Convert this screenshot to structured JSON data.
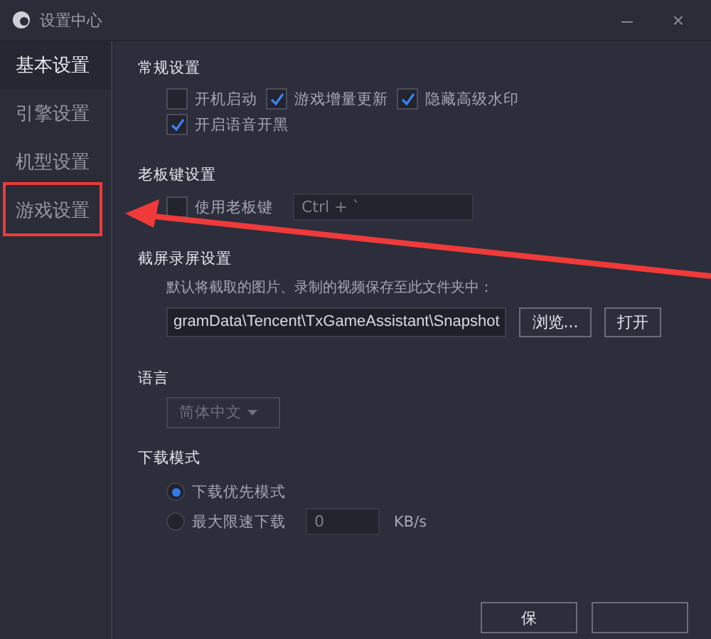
{
  "window": {
    "title": "设置中心",
    "minimize_label": "–",
    "close_label": "×"
  },
  "sidebar": {
    "items": [
      {
        "label": "基本设置",
        "selected": true
      },
      {
        "label": "引擎设置",
        "selected": false
      },
      {
        "label": "机型设置",
        "selected": false
      },
      {
        "label": "游戏设置",
        "selected": false
      }
    ]
  },
  "general": {
    "title": "常规设置",
    "options": [
      {
        "label": "开机启动",
        "checked": false
      },
      {
        "label": "游戏增量更新",
        "checked": true
      },
      {
        "label": "隐藏高级水印",
        "checked": true
      },
      {
        "label": "开启语音开黑",
        "checked": true
      }
    ]
  },
  "boss_key": {
    "title": "老板键设置",
    "label": "使用老板键",
    "checked": false,
    "value": "Ctrl + `"
  },
  "screenshot": {
    "title": "截屏录屏设置",
    "description": "默认将截取的图片、录制的视频保存至此文件夹中：",
    "path": "gramData\\Tencent\\TxGameAssistant\\Snapshot",
    "buttons": [
      "浏览...",
      "打开"
    ]
  },
  "language": {
    "title": "语言",
    "value": "简体中文"
  },
  "download": {
    "title": "下载模式",
    "options": [
      {
        "label": "下载优先模式",
        "selected": true
      },
      {
        "label": "最大限速下载",
        "selected": false
      }
    ],
    "limit": "0",
    "unit": "KB/s"
  },
  "footer": {
    "buttons": [
      "保"
    ]
  },
  "annotations": {
    "highlight_box": true,
    "arrow": true
  }
}
